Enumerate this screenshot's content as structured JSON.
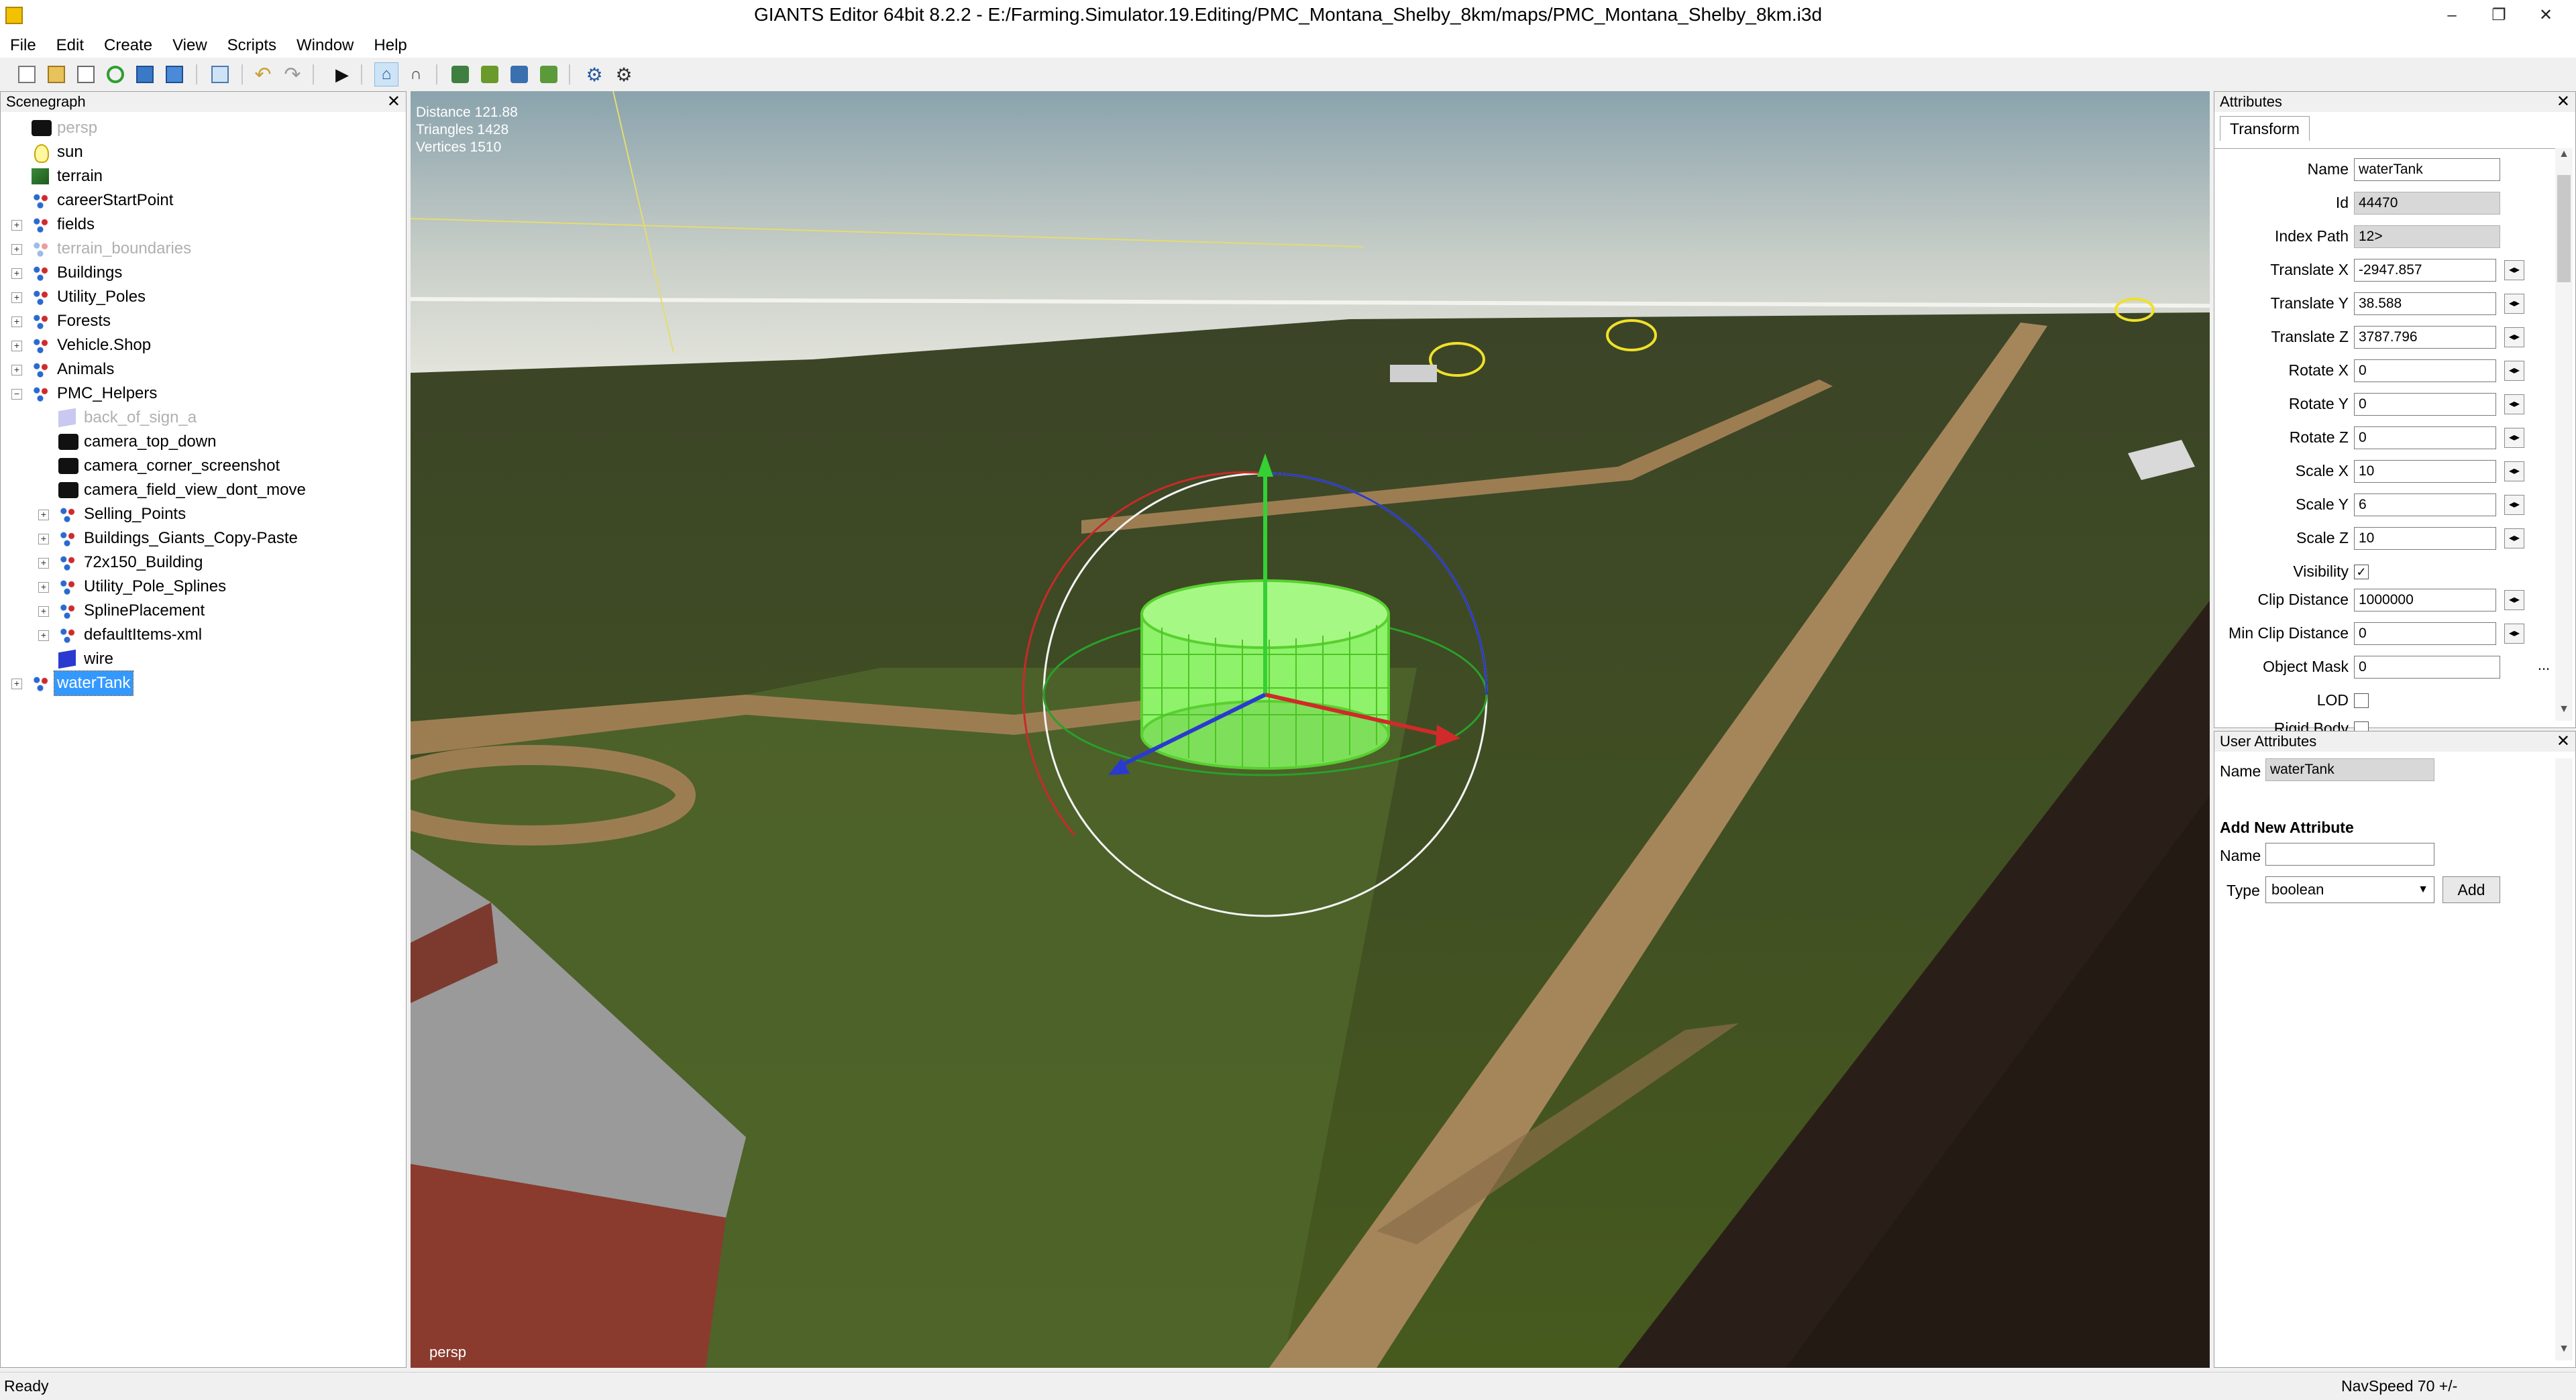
{
  "window": {
    "title": "GIANTS Editor 64bit 8.2.2 - E:/Farming.Simulator.19.Editing/PMC_Montana_Shelby_8km/maps/PMC_Montana_Shelby_8km.i3d",
    "minimize": "–",
    "restore": "❐",
    "close": "✕"
  },
  "menu": [
    "File",
    "Edit",
    "Create",
    "View",
    "Scripts",
    "Window",
    "Help"
  ],
  "scenegraph": {
    "title": "Scenegraph",
    "close": "✕",
    "nodes": [
      {
        "label": "persp"
      },
      {
        "label": "sun"
      },
      {
        "label": "terrain"
      },
      {
        "label": "careerStartPoint"
      },
      {
        "label": "fields"
      },
      {
        "label": "terrain_boundaries"
      },
      {
        "label": "Buildings"
      },
      {
        "label": "Utility_Poles"
      },
      {
        "label": "Forests"
      },
      {
        "label": "Vehicle.Shop"
      },
      {
        "label": "Animals"
      },
      {
        "label": "PMC_Helpers"
      },
      {
        "label": "back_of_sign_a"
      },
      {
        "label": "camera_top_down"
      },
      {
        "label": "camera_corner_screenshot"
      },
      {
        "label": "camera_field_view_dont_move"
      },
      {
        "label": "Selling_Points"
      },
      {
        "label": "Buildings_Giants_Copy-Paste"
      },
      {
        "label": "72x150_Building"
      },
      {
        "label": "Utility_Pole_Splines"
      },
      {
        "label": "SplinePlacement"
      },
      {
        "label": "defaultItems-xml"
      },
      {
        "label": "wire"
      },
      {
        "label": "waterTank"
      }
    ]
  },
  "viewport": {
    "distance": "Distance 121.88",
    "triangles": "Triangles 1428",
    "vertices": "Vertices 1510",
    "camera": "persp"
  },
  "attributes": {
    "title": "Attributes",
    "close": "✕",
    "tab": "Transform",
    "rows": [
      {
        "label": "Name",
        "value": "waterTank"
      },
      {
        "label": "Id",
        "value": "44470"
      },
      {
        "label": "Index Path",
        "value": "12>"
      },
      {
        "label": "Translate X",
        "value": "-2947.857"
      },
      {
        "label": "Translate Y",
        "value": "38.588"
      },
      {
        "label": "Translate Z",
        "value": "3787.796"
      },
      {
        "label": "Rotate X",
        "value": "0"
      },
      {
        "label": "Rotate Y",
        "value": "0"
      },
      {
        "label": "Rotate Z",
        "value": "0"
      },
      {
        "label": "Scale X",
        "value": "10"
      },
      {
        "label": "Scale Y",
        "value": "6"
      },
      {
        "label": "Scale Z",
        "value": "10"
      },
      {
        "label": "Visibility",
        "value": "✓"
      },
      {
        "label": "Clip Distance",
        "value": "1000000"
      },
      {
        "label": "Min Clip Distance",
        "value": "0"
      },
      {
        "label": "Object Mask",
        "value": "0"
      },
      {
        "label": "LOD",
        "value": ""
      },
      {
        "label": "Rigid Body",
        "value": ""
      }
    ],
    "spin": "◂▸",
    "more": "..."
  },
  "user_attributes": {
    "title": "User Attributes",
    "close": "✕",
    "name_label": "Name",
    "name_value": "waterTank",
    "add_title": "Add New Attribute",
    "new_name_label": "Name",
    "new_name_value": "",
    "type_label": "Type",
    "type_value": "boolean",
    "add_button": "Add"
  },
  "status": {
    "left": "Ready",
    "right": "NavSpeed 70 +/-"
  }
}
